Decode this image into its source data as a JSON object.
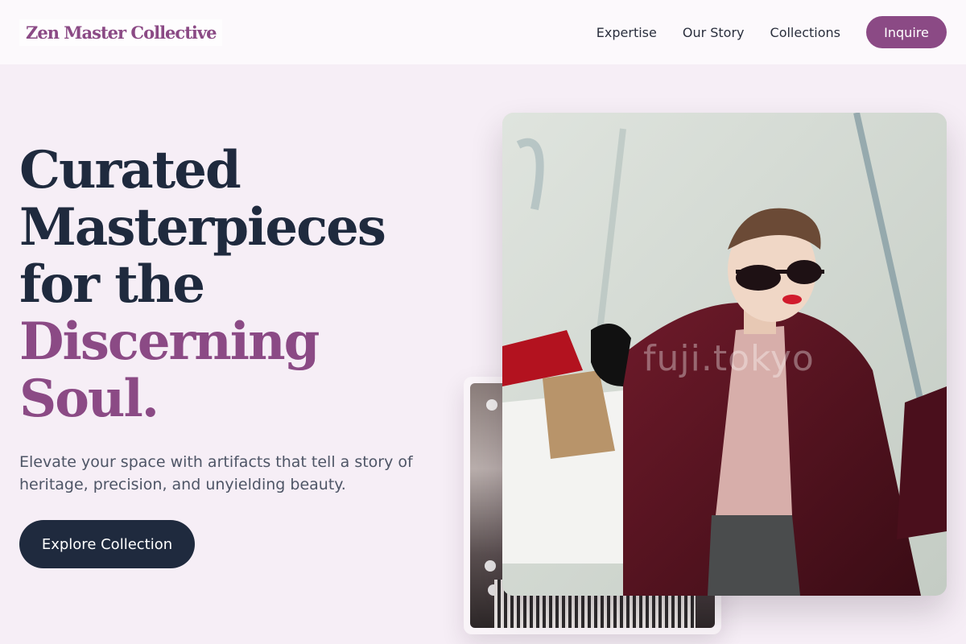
{
  "header": {
    "logo": "Zen Master Collective",
    "nav": [
      {
        "label": "Expertise"
      },
      {
        "label": "Our Story"
      },
      {
        "label": "Collections"
      }
    ],
    "cta_label": "Inquire"
  },
  "hero": {
    "title_line_1": "Curated",
    "title_line_2": "Masterpieces",
    "title_line_3": "for the",
    "title_accent_1": "Discerning",
    "title_accent_2": "Soul.",
    "subtitle": "Elevate your space with artifacts that tell a story of heritage, precision, and unyielding beauty.",
    "cta_label": "Explore Collection"
  },
  "images": {
    "main_watermark": "fuji.tokyo"
  },
  "colors": {
    "accent": "#8b4a85",
    "dark": "#1f2a3e",
    "background": "#f6eef6"
  }
}
